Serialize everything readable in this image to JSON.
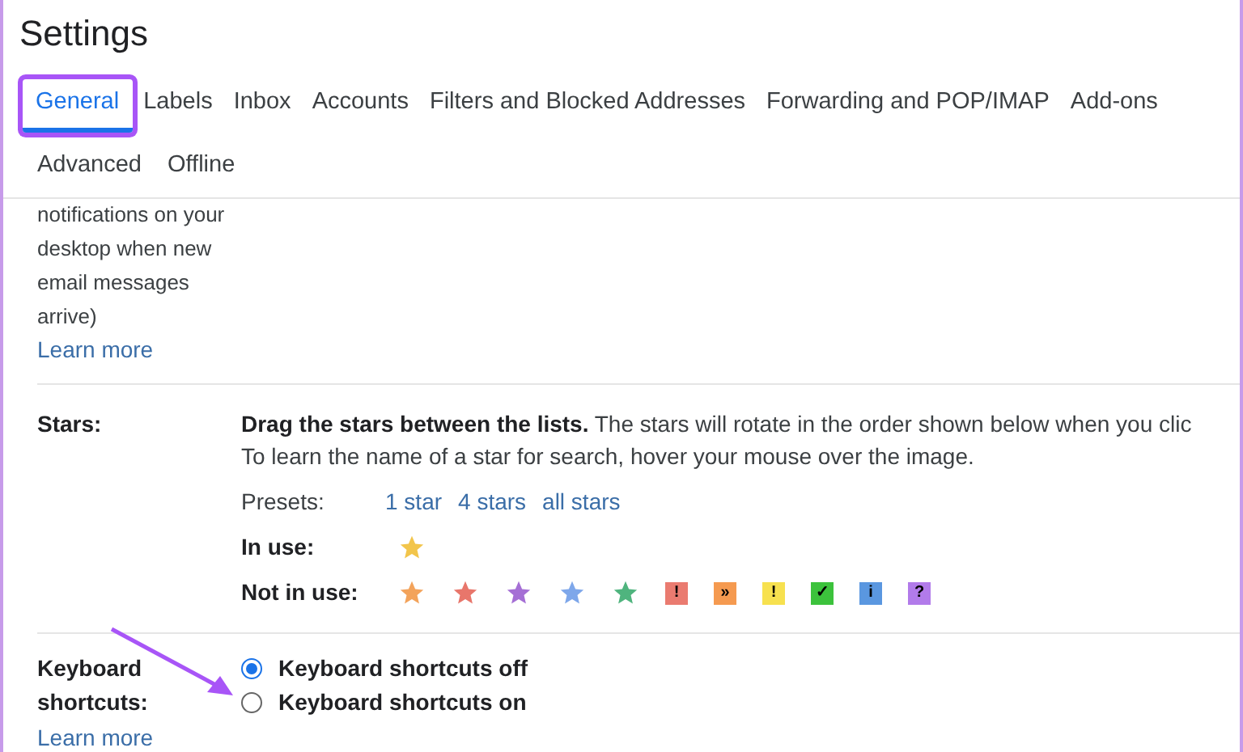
{
  "title": "Settings",
  "tabs": [
    {
      "label": "General",
      "selected": true
    },
    {
      "label": "Labels",
      "selected": false
    },
    {
      "label": "Inbox",
      "selected": false
    },
    {
      "label": "Accounts",
      "selected": false
    },
    {
      "label": "Filters and Blocked Addresses",
      "selected": false
    },
    {
      "label": "Forwarding and POP/IMAP",
      "selected": false
    },
    {
      "label": "Add-ons",
      "selected": false
    },
    {
      "label": "Advanced",
      "selected": false
    },
    {
      "label": "Offline",
      "selected": false
    }
  ],
  "notifications": {
    "lines": [
      "notifications on your",
      "desktop when new",
      "email messages",
      "arrive)"
    ],
    "link": "Learn more"
  },
  "stars": {
    "label": "Stars:",
    "lead": "Drag the stars between the lists.",
    "text": "The stars will rotate in the order shown below when you clic",
    "line2": "To learn the name of a star for search, hover your mouse over the image.",
    "presets_label": "Presets:",
    "presets": [
      "1 star",
      "4 stars",
      "all stars"
    ],
    "in_use_label": "In use:",
    "in_use": [
      {
        "kind": "star",
        "color": "#f2c54b"
      }
    ],
    "not_in_use_label": "Not in use:",
    "not_in_use": [
      {
        "kind": "star",
        "color": "#f3a35b"
      },
      {
        "kind": "star",
        "color": "#e8766b"
      },
      {
        "kind": "star",
        "color": "#a56fd5"
      },
      {
        "kind": "star",
        "color": "#7ea7ea"
      },
      {
        "kind": "star",
        "color": "#4fb47e"
      },
      {
        "kind": "badge",
        "color": "#ea7b70",
        "symbol": "!"
      },
      {
        "kind": "badge",
        "color": "#f59a50",
        "symbol": "»"
      },
      {
        "kind": "badge",
        "color": "#f7e14f",
        "symbol": "!"
      },
      {
        "kind": "badge",
        "color": "#3cc23c",
        "symbol": "✓"
      },
      {
        "kind": "badge",
        "color": "#5a97e0",
        "symbol": "i"
      },
      {
        "kind": "badge",
        "color": "#b27bea",
        "symbol": "?"
      }
    ]
  },
  "keyboard": {
    "label": "Keyboard shortcuts:",
    "link": "Learn more",
    "options": [
      {
        "label": "Keyboard shortcuts off",
        "selected": true
      },
      {
        "label": "Keyboard shortcuts on",
        "selected": false
      }
    ]
  }
}
